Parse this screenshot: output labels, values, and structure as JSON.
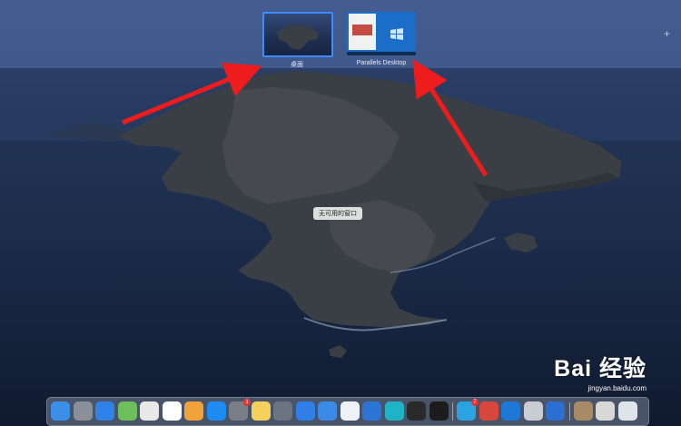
{
  "mission_control": {
    "spaces": [
      {
        "id": "desktop",
        "label": "桌面"
      },
      {
        "id": "parallels",
        "label": "Parallels Desktop"
      }
    ],
    "add_space_label": "+"
  },
  "desktop": {
    "tooltip": "无可用的窗口"
  },
  "watermark": {
    "text": "Bai 经验",
    "url": "jingyan.baidu.com"
  },
  "annotations": {
    "arrow_color": "#ee1c1c"
  },
  "dock": {
    "apps": [
      {
        "name": "finder-icon",
        "color": "#3b8fe8"
      },
      {
        "name": "launchpad-icon",
        "color": "#8a8f99"
      },
      {
        "name": "safari-icon",
        "color": "#2f83e8"
      },
      {
        "name": "maps-icon",
        "color": "#6cbf5a"
      },
      {
        "name": "chrome-icon",
        "color": "#e8e8e8"
      },
      {
        "name": "qq-icon",
        "color": "#ffffff"
      },
      {
        "name": "photos-icon",
        "color": "#f2a23a"
      },
      {
        "name": "app-store-icon",
        "color": "#1d8bf1"
      },
      {
        "name": "system-preferences-icon",
        "color": "#7a7e86",
        "badge": "1"
      },
      {
        "name": "notes-icon",
        "color": "#f3d15a"
      },
      {
        "name": "screenshot-icon",
        "color": "#6d7481"
      },
      {
        "name": "kugou-icon",
        "color": "#2f7fe6"
      },
      {
        "name": "feishu-icon",
        "color": "#3b8ae6"
      },
      {
        "name": "preview-icon",
        "color": "#eef2f7"
      },
      {
        "name": "xcode-icon",
        "color": "#2c74d6"
      },
      {
        "name": "ucloud-icon",
        "color": "#1fb3c6"
      },
      {
        "name": "terminal-icon",
        "color": "#2a2a2a"
      },
      {
        "name": "activity-monitor-icon",
        "color": "#1c1c1c"
      },
      {
        "name": "telegram-icon",
        "color": "#2aa3e0",
        "badge": "7"
      },
      {
        "name": "parallels-windows-icon",
        "color": "#d9473c"
      },
      {
        "name": "windows-tiles-icon",
        "color": "#1e78d6"
      },
      {
        "name": "parallels-control-icon",
        "color": "#c9ccd3"
      },
      {
        "name": "windows-app-icon",
        "color": "#2a6fd1"
      },
      {
        "name": "document-thumb-icon",
        "color": "#a88b66"
      },
      {
        "name": "screenshot-thumb-icon",
        "color": "#d8d8d8"
      },
      {
        "name": "trash-icon",
        "color": "#dfe3ea"
      }
    ]
  }
}
